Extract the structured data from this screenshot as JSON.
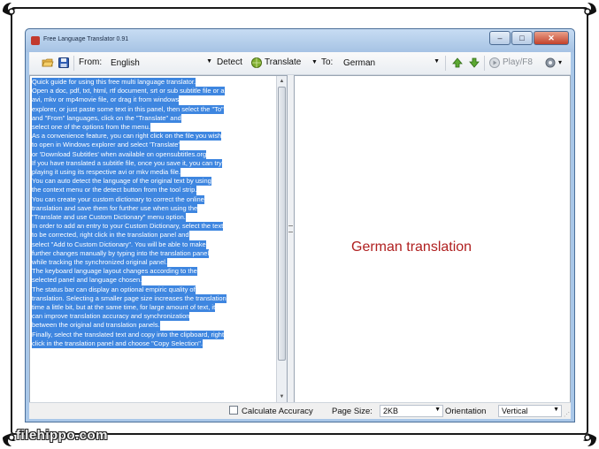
{
  "window": {
    "title": "Free Language Translator 0.91",
    "minimize": "–",
    "maximize": "□",
    "close": "✕"
  },
  "toolbar": {
    "from_label": "From:",
    "from_value": "English",
    "detect_label": "Detect",
    "translate_label": "Translate",
    "to_label": "To:",
    "to_value": "German",
    "play_label": "Play/F8",
    "dropdown_arrow": "▼",
    "menu_arrow": "▾"
  },
  "source_text": [
    "Quick guide for using this free multi language translator.",
    "Open a doc, pdf, txt, html, rtf document, srt or sub subtitle file or a",
    "avi, mkv or mp4movie file, or drag it from windows",
    "explorer, or just paste some text in this panel, then select the \"To\"",
    "and \"From\" languages, click on the \"Translate\" and",
    "select one of the options from the menu.",
    "As a convenience feature, you can right click on the file you wish",
    "to open in Windows explorer and select 'Translate'",
    "or 'Download Subtitles' when available on opensubtitles.org",
    "If you have translated a subtitle file, once you save it, you can try",
    "playing it using its respective avi or mkv media file.",
    "You can auto detect the language of the original text by using",
    "the context menu or the detect button from the tool strip.",
    "You can create your custom dictionary to correct the online",
    "translation and save them for further use when using the",
    "\"Translate and use Custom Dictionary\" menu option.",
    "In order to add an entry to your Custom Dictionary, select the text",
    "to be corrected, right click in the translation panel and",
    "select \"Add to Custom Dictionary\". You will be able to make",
    "further changes manually by typing into the translation panel",
    "while tracking the synchronized original panel.",
    "The keyboard language layout changes according to the",
    "selected panel and language chosen.",
    "The status bar can display an optional empiric quality of",
    "translation. Selecting a smaller page size increases the translation",
    "time a little bit, but at the same time, for large amount of text, it",
    "can improve translation accuracy and synchronization",
    "between the original and translation panels.",
    "Finally, select the translated text and copy into the clipboard, right",
    "click in the translation panel and choose \"Copy Selection\"."
  ],
  "translation_text": "German translation",
  "statusbar": {
    "calculate_accuracy": "Calculate Accuracy",
    "page_size_label": "Page Size:",
    "page_size_value": "2KB",
    "orientation_label": "Orientation",
    "orientation_value": "Vertical",
    "size_grip": "⋰"
  },
  "watermark": "filehippo.com",
  "colors": {
    "selection": "#3e86e0",
    "translation_text": "#b02020",
    "title_bar": "#a9c7e8"
  }
}
